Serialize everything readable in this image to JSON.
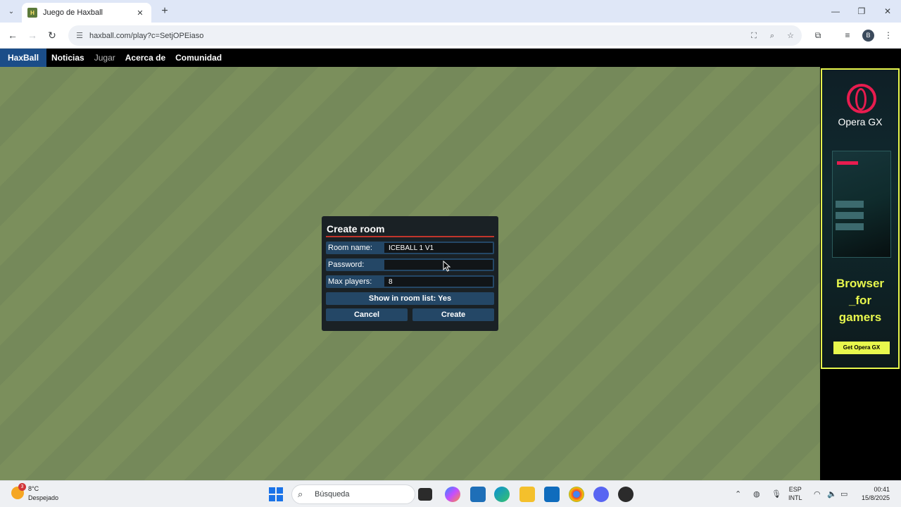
{
  "browser": {
    "tab_title": "Juego de Haxball",
    "url": "haxball.com/play?c=SetjOPEiaso",
    "profile_initial": "B"
  },
  "site_nav": {
    "brand": "HaxBall",
    "links": [
      "Noticias",
      "Jugar",
      "Acerca de",
      "Comunidad"
    ],
    "active": "Jugar"
  },
  "dialog": {
    "title": "Create room",
    "room_name_label": "Room name:",
    "room_name_value": "ICEBALL 1 V1",
    "password_label": "Password:",
    "password_value": "",
    "max_players_label": "Max players:",
    "max_players_value": "8",
    "show_in_list": "Show in room list: Yes",
    "cancel_label": "Cancel",
    "create_label": "Create"
  },
  "ad": {
    "brand": "Opera GX",
    "headline": "Browser\n_for\ngamers",
    "cta": "Get Opera GX",
    "accent_color": "#e8f74d",
    "logo_color": "#e81c4f"
  },
  "taskbar": {
    "weather_temp": "8°C",
    "weather_condition": "Despejado",
    "weather_badge": "3",
    "search_placeholder": "Búsqueda",
    "lang_line1": "ESP",
    "lang_line2": "INTL",
    "time": "00:41",
    "date": "15/8/2025"
  },
  "colors": {
    "field_bg": "#244766",
    "dialog_bg": "#1a2125",
    "title_underline": "#c1352c",
    "pitch": "#7b8f5c",
    "brand_bg": "#1b4d88"
  }
}
